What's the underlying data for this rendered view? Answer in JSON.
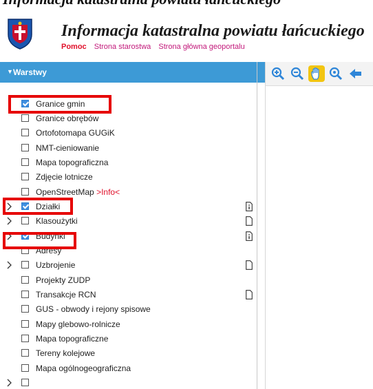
{
  "app": {
    "cropped_top_text": "Informacja katastralna powiatu łańcuckiego",
    "title": "Informacja katastralna powiatu łańcuckiego",
    "links": [
      "Pomoc",
      "Strona starostwa",
      "Strona główna geoportalu"
    ]
  },
  "colors": {
    "accent": "#3d9ad6",
    "highlight": "#e60000",
    "checkbox_on": "#3f8fe0",
    "help_link": "#e0102a",
    "links": "#c2187a"
  },
  "sidebar": {
    "header": "Warstwy",
    "layers": [
      {
        "label": "Granice gmin",
        "checked": true
      },
      {
        "label": "Granice obrębów",
        "checked": false
      },
      {
        "label": "Ortofotomapa GUGiK",
        "checked": false
      },
      {
        "label": "NMT-cieniowanie",
        "checked": false
      },
      {
        "label": "Mapa topograficzna",
        "checked": false
      },
      {
        "label": "Zdjęcie lotnicze",
        "checked": false
      },
      {
        "label": "OpenStreetMap ",
        "info": ">Info<",
        "checked": false
      },
      {
        "label": "Działki",
        "checked": true,
        "expandable": true,
        "doc": "info-doc"
      },
      {
        "label": "Klasoużytki",
        "checked": false,
        "expandable": true,
        "doc": "doc"
      },
      {
        "label": "Budynki",
        "checked": true,
        "expandable": true,
        "doc": "info-doc"
      },
      {
        "label": "Adresy",
        "checked": false
      },
      {
        "label": "Uzbrojenie",
        "checked": false,
        "expandable": true,
        "doc": "doc"
      },
      {
        "label": "Projekty ZUDP",
        "checked": false
      },
      {
        "label": "Transakcje RCN",
        "checked": false,
        "doc": "doc"
      },
      {
        "label": "GUS - obwody i rejony spisowe",
        "checked": false
      },
      {
        "label": "Mapy glebowo-rolnicze",
        "checked": false
      },
      {
        "label": "Mapa topograficzne",
        "checked": false
      },
      {
        "label": "Tereny kolejowe",
        "checked": false
      },
      {
        "label": "Mapa ogólnogeograficzna",
        "checked": false
      }
    ]
  },
  "toolbar": {
    "tools": [
      "zoom-in-icon",
      "zoom-out-icon",
      "pan-hand-icon",
      "zoom-extent-icon",
      "back-arrow-icon"
    ]
  }
}
